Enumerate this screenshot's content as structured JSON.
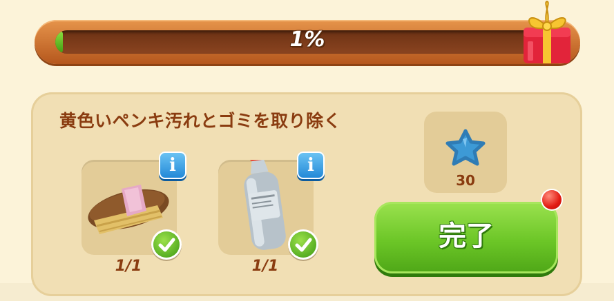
{
  "progress": {
    "label": "1%",
    "fraction": 0.01,
    "fill_color": "#5dbb1e"
  },
  "reward_chest": {
    "icon": "gift-box-icon"
  },
  "task": {
    "title": "黄色いペンキ汚れとゴミを取り除く",
    "items": [
      {
        "icon": "brush-icon",
        "count": "1/1",
        "info_label": "i",
        "completed": true
      },
      {
        "icon": "solvent-bottle-icon",
        "count": "1/1",
        "info_label": "i",
        "completed": true
      }
    ],
    "reward": {
      "icon": "blue-star-icon",
      "value": "30"
    },
    "complete_button": {
      "label": "完了",
      "has_notification": true
    }
  },
  "colors": {
    "accent_text": "#8a3c10",
    "button_green": "#6cc627",
    "info_blue": "#1f86d6",
    "notification_red": "#e21b12"
  }
}
